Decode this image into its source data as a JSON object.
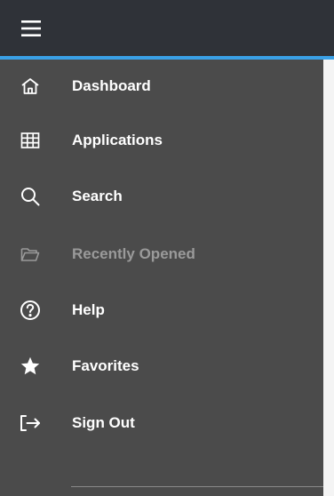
{
  "colors": {
    "drawer_bg": "#4b4b4b",
    "topbar_bg": "#2f3238",
    "accent": "#3aa0e6",
    "text": "#ffffff",
    "text_disabled": "#9a9a9a"
  },
  "topbar": {
    "menu_icon": "hamburger-icon"
  },
  "nav": {
    "items": [
      {
        "label": "Dashboard",
        "icon": "home-icon",
        "enabled": true
      },
      {
        "label": "Applications",
        "icon": "grid-icon",
        "enabled": true
      },
      {
        "label": "Search",
        "icon": "search-icon",
        "enabled": true
      },
      {
        "label": "Recently Opened",
        "icon": "folder-open-icon",
        "enabled": false
      },
      {
        "label": "Help",
        "icon": "help-circle-icon",
        "enabled": true
      },
      {
        "label": "Favorites",
        "icon": "star-icon",
        "enabled": true
      },
      {
        "label": "Sign Out",
        "icon": "sign-out-icon",
        "enabled": true
      }
    ]
  }
}
